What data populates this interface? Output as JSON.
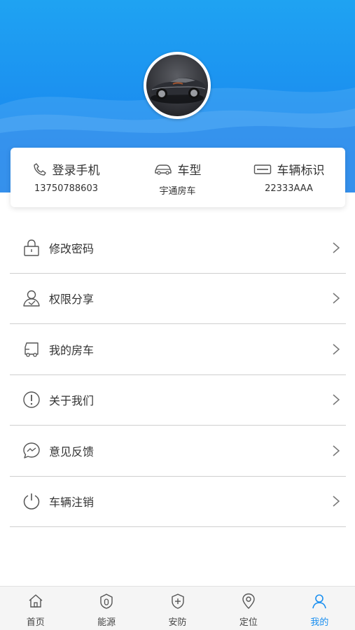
{
  "profile": {
    "avatar_icon": "sports-car-photo"
  },
  "info": {
    "phone": {
      "title": "登录手机",
      "value": "13750788603",
      "icon": "phone-icon"
    },
    "model": {
      "title": "车型",
      "value": "宇通房车",
      "icon": "car-icon"
    },
    "vehicle_id": {
      "title": "车辆标识",
      "value": "22333AAA",
      "icon": "id-card-icon"
    }
  },
  "menu": {
    "items": [
      {
        "label": "修改密码",
        "icon": "lock-icon"
      },
      {
        "label": "权限分享",
        "icon": "user-share-icon"
      },
      {
        "label": "我的房车",
        "icon": "rv-icon"
      },
      {
        "label": "关于我们",
        "icon": "info-icon"
      },
      {
        "label": "意见反馈",
        "icon": "message-icon"
      },
      {
        "label": "车辆注销",
        "icon": "power-icon"
      }
    ]
  },
  "tabbar": {
    "tabs": [
      {
        "label": "首页",
        "icon": "home-icon"
      },
      {
        "label": "能源",
        "icon": "energy-icon"
      },
      {
        "label": "安防",
        "icon": "shield-icon"
      },
      {
        "label": "定位",
        "icon": "location-icon"
      },
      {
        "label": "我的",
        "icon": "user-icon",
        "active": true
      }
    ],
    "active_color": "#1a8ff0"
  },
  "colors": {
    "header": "#1b8ff0",
    "accent": "#1a8ff0"
  }
}
